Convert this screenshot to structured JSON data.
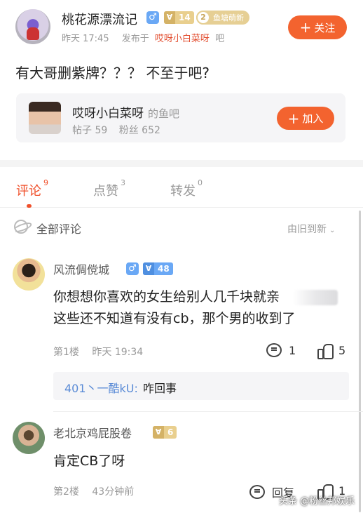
{
  "post": {
    "author": "桃花源漂流记",
    "gender_symbol": "♂",
    "level_icon": "∀",
    "level": "14",
    "title_level": "2",
    "title_badge": "鱼塘萌新",
    "time": "昨天 17:45",
    "posted_in_prefix": "发布于",
    "forum": "哎呀小白菜呀",
    "posted_in_suffix": "吧",
    "follow_label": "关注",
    "content": "有大哥删紫牌？？？ 不至于吧?"
  },
  "forum_card": {
    "name": "哎呀小白菜呀",
    "suffix": "的鱼吧",
    "posts_label": "帖子 59",
    "fans_label": "粉丝 652",
    "join_label": "加入"
  },
  "tabs": [
    {
      "label": "评论",
      "count": "9",
      "active": true
    },
    {
      "label": "点赞",
      "count": "3",
      "active": false
    },
    {
      "label": "转发",
      "count": "0",
      "active": false
    }
  ],
  "list_header": {
    "title": "全部评论",
    "sort": "由旧到新"
  },
  "comments": [
    {
      "name": "风流倜傥城",
      "gender_symbol": "♂",
      "level_icon": "∀",
      "level": "48",
      "line1": "你想想你喜欢的女生给别人几千块就亲",
      "line2": "这些还不知道有没有cb，那个男的收到了",
      "floor": "第1楼",
      "time": "昨天 19:34",
      "reply_count": "1",
      "like_count": "5",
      "reply": {
        "name": "401丶一酷kU:",
        "text": "咋回事"
      }
    },
    {
      "name": "老北京鸡屁股卷",
      "level_icon": "∀",
      "level": "6",
      "line1": "肯定CB了呀",
      "floor": "第2楼",
      "time": "43分钟前",
      "reply_label": "回复",
      "like_count": "1"
    }
  ],
  "watermark": "头条 @粉丝邦娱乐",
  "colors": {
    "accent": "#f3632f",
    "link_blue": "#5a8bd6",
    "gold": "#e9cf8e",
    "gender_blue": "#6aa8f5"
  }
}
